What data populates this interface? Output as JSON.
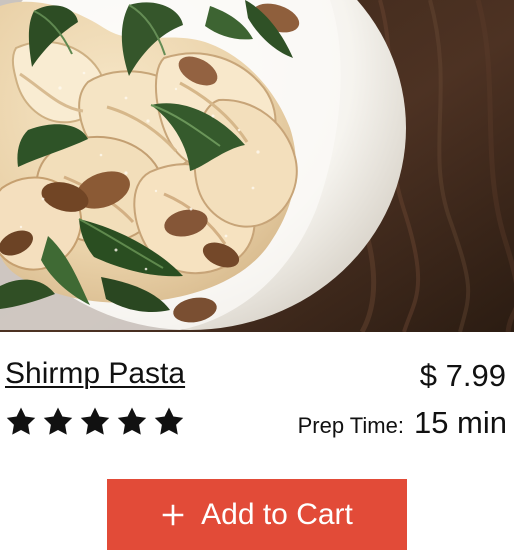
{
  "product": {
    "image_icon": "shrimp-pasta-photo",
    "title": "Shirmp Pasta",
    "price": "$ 7.99",
    "rating": 5,
    "rating_max": 5,
    "star_color": "#111111",
    "prep_time_label": "Prep Time:",
    "prep_time_value": "15 min"
  },
  "cart_button": {
    "label": "Add to Cart",
    "icon": "plus-icon",
    "color": "#e24b38"
  }
}
